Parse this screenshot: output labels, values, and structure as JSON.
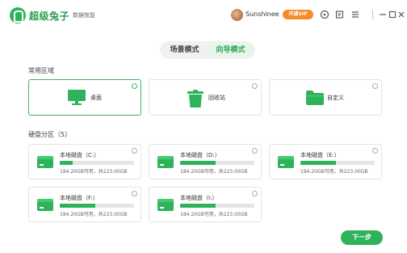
{
  "app": {
    "brand": "超级兔子",
    "subtitle": "数据恢复"
  },
  "user": {
    "name": "Sunshinee",
    "vip_label": "开通VIP"
  },
  "modes": [
    {
      "label": "场景模式",
      "active": false
    },
    {
      "label": "向导模式",
      "active": true
    }
  ],
  "common_areas": {
    "title": "常用区域",
    "items": [
      {
        "label": "桌面",
        "icon": "desktop-icon",
        "selected": true
      },
      {
        "label": "回收站",
        "icon": "recycle-bin-icon",
        "selected": false
      },
      {
        "label": "自定义",
        "icon": "folder-icon",
        "selected": false
      }
    ]
  },
  "partitions": {
    "title": "硬盘分区（5）",
    "items": [
      {
        "name": "本地磁盘（C:）",
        "usage": "184.20GB可用，共223.00GB",
        "used_fraction": 0.17
      },
      {
        "name": "本地磁盘（D:）",
        "usage": "184.20GB可用，共223.00GB",
        "used_fraction": 0.48
      },
      {
        "name": "本地磁盘（E:）",
        "usage": "184.20GB可用，共223.00GB",
        "used_fraction": 0.48
      },
      {
        "name": "本地磁盘（F:）",
        "usage": "184.20GB可用，共223.00GB",
        "used_fraction": 0.48
      },
      {
        "name": "本地磁盘（I:）",
        "usage": "184.20GB可用，共223.00GB",
        "used_fraction": 0.48
      }
    ]
  },
  "actions": {
    "next_label": "下一步"
  },
  "colors": {
    "accent": "#2fb35a",
    "vip": "#f58a2a"
  }
}
